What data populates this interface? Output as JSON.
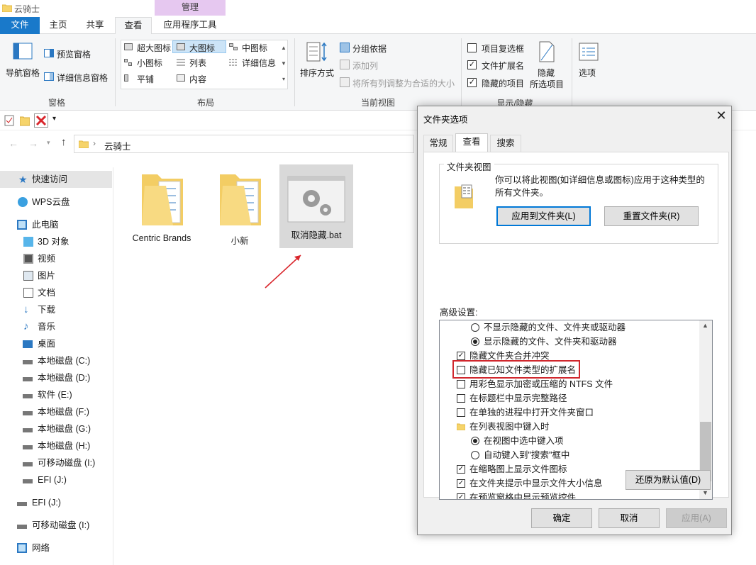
{
  "window": {
    "title": "云骑士",
    "context_tab": "管理"
  },
  "ribbon_tabs": [
    "文件",
    "主页",
    "共享",
    "查看",
    "应用程序工具"
  ],
  "ribbon": {
    "pane_group": {
      "nav_pane": "导航窗格",
      "preview_pane": "预览窗格",
      "details_pane": "详细信息窗格",
      "label": "窗格"
    },
    "layout_group": {
      "items": [
        "超大图标",
        "大图标",
        "中图标",
        "小图标",
        "列表",
        "详细信息",
        "平铺",
        "内容"
      ],
      "label": "布局"
    },
    "view_group": {
      "sort_by": "排序方式",
      "group_by": "分组依据",
      "add_column": "添加列",
      "fit_columns": "将所有列调整为合适的大小",
      "label": "当前视图"
    },
    "showhide_group": {
      "item_checkboxes": "项目复选框",
      "file_extensions": "文件扩展名",
      "hidden_items": "隐藏的项目",
      "hide_selected_1": "隐藏",
      "hide_selected_2": "所选项目",
      "label": "显示/隐藏"
    },
    "options": "选项"
  },
  "address": {
    "path": "云骑士"
  },
  "nav": [
    "快速访问",
    "WPS云盘",
    "此电脑",
    "3D 对象",
    "视频",
    "图片",
    "文档",
    "下载",
    "音乐",
    "桌面",
    "本地磁盘 (C:)",
    "本地磁盘 (D:)",
    "软件 (E:)",
    "本地磁盘 (F:)",
    "本地磁盘 (G:)",
    "本地磁盘 (H:)",
    "可移动磁盘 (I:)",
    "EFI (J:)",
    "EFI (J:)",
    "可移动磁盘 (I:)",
    "网络"
  ],
  "files": [
    "Centric Brands",
    "小新",
    "取消隐藏.bat"
  ],
  "dialog": {
    "title": "文件夹选项",
    "tabs": [
      "常规",
      "查看",
      "搜索"
    ],
    "folder_view_label": "文件夹视图",
    "folder_view_desc": "你可以将此视图(如详细信息或图标)应用于这种类型的所有文件夹。",
    "apply_to_folders": "应用到文件夹(L)",
    "reset_folders": "重置文件夹(R)",
    "advanced_label": "高级设置:",
    "advanced": [
      {
        "type": "radio",
        "checked": false,
        "indent": 1,
        "label": "不显示隐藏的文件、文件夹或驱动器"
      },
      {
        "type": "radio",
        "checked": true,
        "indent": 1,
        "label": "显示隐藏的文件、文件夹和驱动器"
      },
      {
        "type": "check",
        "checked": true,
        "indent": 0,
        "label": "隐藏文件夹合并冲突"
      },
      {
        "type": "check",
        "checked": false,
        "indent": 0,
        "label": "隐藏已知文件类型的扩展名",
        "highlight": true
      },
      {
        "type": "check",
        "checked": false,
        "indent": 0,
        "label": "用彩色显示加密或压缩的 NTFS 文件"
      },
      {
        "type": "check",
        "checked": false,
        "indent": 0,
        "label": "在标题栏中显示完整路径"
      },
      {
        "type": "check",
        "checked": false,
        "indent": 0,
        "label": "在单独的进程中打开文件夹窗口"
      },
      {
        "type": "folder",
        "checked": false,
        "indent": 0,
        "label": "在列表视图中键入时"
      },
      {
        "type": "radio",
        "checked": true,
        "indent": 1,
        "label": "在视图中选中键入项"
      },
      {
        "type": "radio",
        "checked": false,
        "indent": 1,
        "label": "自动键入到\"搜索\"框中"
      },
      {
        "type": "check",
        "checked": true,
        "indent": 0,
        "label": "在缩略图上显示文件图标"
      },
      {
        "type": "check",
        "checked": true,
        "indent": 0,
        "label": "在文件夹提示中显示文件大小信息"
      },
      {
        "type": "check",
        "checked": true,
        "indent": 0,
        "label": "在预览窗格中显示预览控件"
      }
    ],
    "restore_defaults": "还原为默认值(D)",
    "ok": "确定",
    "cancel": "取消",
    "apply": "应用(A)"
  },
  "colors": {
    "file_tab": "#1979ca",
    "manage_tab": "#e6c8f0",
    "highlight_box": "#d0272d",
    "arrow": "#d9262c"
  }
}
